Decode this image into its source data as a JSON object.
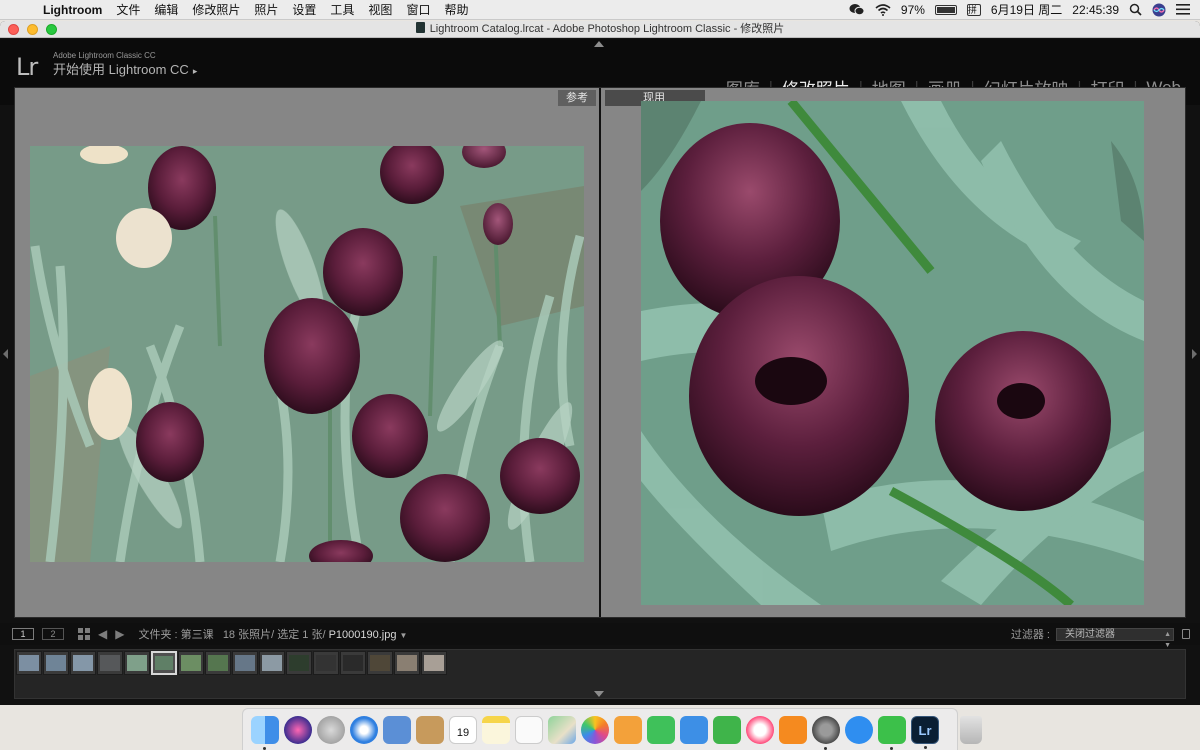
{
  "menubar": {
    "app": "Lightroom",
    "items": [
      "文件",
      "编辑",
      "修改照片",
      "照片",
      "设置",
      "工具",
      "视图",
      "窗口",
      "帮助"
    ],
    "battery": "97%",
    "date": "6月19日 周二",
    "time": "22:45:39"
  },
  "window": {
    "title": "Lightroom Catalog.lrcat - Adobe Photoshop Lightroom Classic - 修改照片"
  },
  "identity": {
    "logo": "Lr",
    "product": "Adobe Lightroom Classic CC",
    "cta": "开始使用 Lightroom CC",
    "cta_arrow": "▸"
  },
  "modules": {
    "items": [
      {
        "label": "图库",
        "active": false
      },
      {
        "label": "修改照片",
        "active": true
      },
      {
        "label": "地图",
        "active": false
      },
      {
        "label": "画册",
        "active": false
      },
      {
        "label": "幻灯片放映",
        "active": false
      },
      {
        "label": "打印",
        "active": false
      },
      {
        "label": "Web",
        "active": false
      }
    ]
  },
  "compare": {
    "reference_label": "参考",
    "active_label": "现用"
  },
  "film_header": {
    "screen1": "1",
    "screen2": "2",
    "folder": "文件夹 : 第三课",
    "count": "18 张照片/ 选定 1 张/",
    "filename": "P1000190.jpg",
    "filter_label": "过滤器 :",
    "filter_value": "关闭过滤器"
  },
  "filmstrip": {
    "selected_index": 5,
    "thumb_colors": [
      "#7c8fa2",
      "#6f8497",
      "#8497a8",
      "#56585a",
      "#7fa08a",
      "#5f7f66",
      "#6c8e63",
      "#55764f",
      "#667788",
      "#8c9aa4",
      "#2d3d2d",
      "#333333",
      "#2a2a2a",
      "#4f4738",
      "#8a7f72",
      "#a89f96"
    ]
  },
  "dock": {
    "apps": [
      "finder",
      "siri",
      "launchpad",
      "safari",
      "photo-preview",
      "contacts",
      "calendar",
      "notes",
      "reminders",
      "maps",
      "photos",
      "pages",
      "facetime",
      "keynote",
      "numbers",
      "music",
      "books",
      "system-preferences",
      "app-store",
      "wechat",
      "lightroom",
      "trash"
    ],
    "calendar_day": "19",
    "lightroom_label": "Lr"
  },
  "icons": [
    "apple-icon",
    "wechat-status-icon",
    "wifi-icon",
    "battery-icon",
    "input-method-icon",
    "search-icon",
    "siri-icon",
    "menu-list-icon"
  ]
}
